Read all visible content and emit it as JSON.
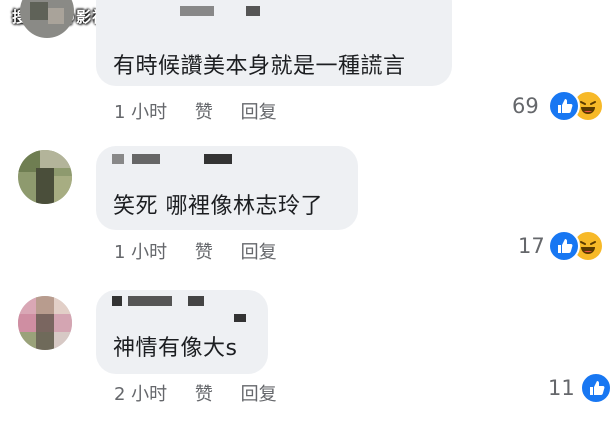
{
  "watermark": "搜狐号@影视大豪侠",
  "comments": [
    {
      "text": "有時候讚美本身就是一種謊言",
      "time": "1 小时",
      "like_label": "赞",
      "reply_label": "回复",
      "reaction_count": "69",
      "reactions": [
        "like",
        "haha"
      ]
    },
    {
      "text": "笑死 哪裡像林志玲了",
      "time": "1 小时",
      "like_label": "赞",
      "reply_label": "回复",
      "reaction_count": "17",
      "reactions": [
        "like",
        "haha"
      ]
    },
    {
      "text": "神情有像大s",
      "time": "2 小时",
      "like_label": "赞",
      "reply_label": "回复",
      "reaction_count": "11",
      "reactions": [
        "like",
        "haha"
      ]
    }
  ],
  "colors": {
    "bubble": "#eef0f3",
    "meta_text": "#65676b",
    "like_blue": "#1877f2",
    "haha_yellow": "#f7b928"
  }
}
